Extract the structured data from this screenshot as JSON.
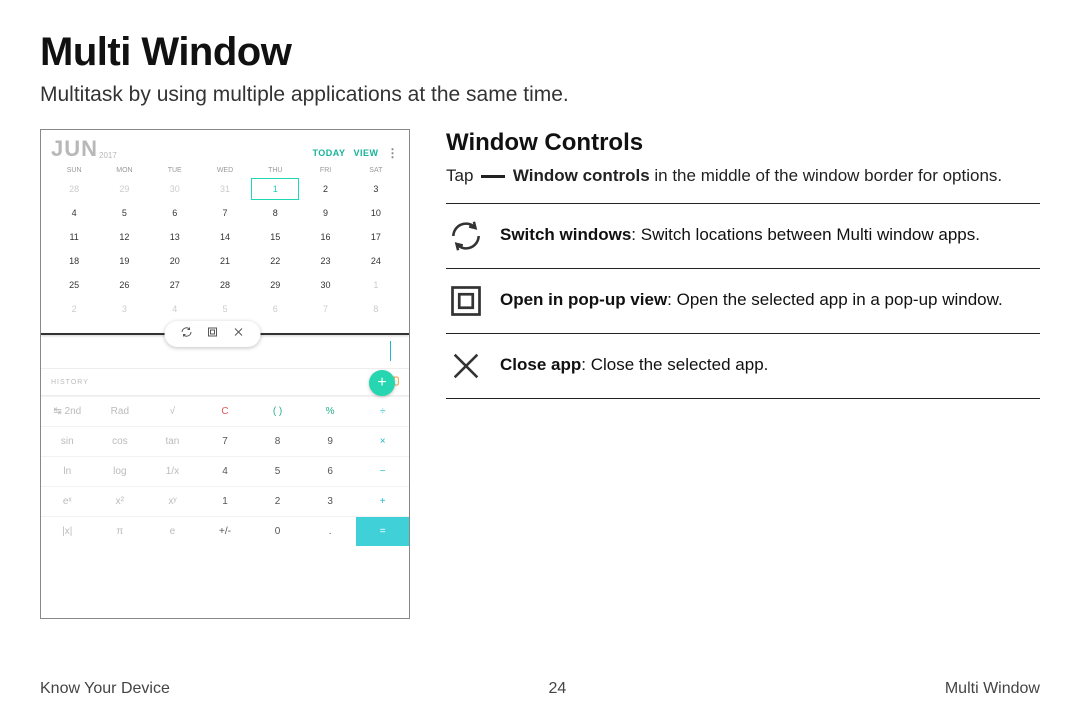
{
  "title": "Multi Window",
  "subtitle": "Multitask by using multiple applications at the same time.",
  "screenshot": {
    "calendar": {
      "month": "JUN",
      "year": "2017",
      "today_label": "TODAY",
      "view_label": "VIEW",
      "dow": [
        "SUN",
        "MON",
        "TUE",
        "WED",
        "THU",
        "FRI",
        "SAT"
      ],
      "weeks": [
        [
          "28",
          "29",
          "30",
          "31",
          "1",
          "2",
          "3"
        ],
        [
          "4",
          "5",
          "6",
          "7",
          "8",
          "9",
          "10"
        ],
        [
          "11",
          "12",
          "13",
          "14",
          "15",
          "16",
          "17"
        ],
        [
          "18",
          "19",
          "20",
          "21",
          "22",
          "23",
          "24"
        ],
        [
          "25",
          "26",
          "27",
          "28",
          "29",
          "30",
          "1"
        ],
        [
          "2",
          "3",
          "4",
          "5",
          "6",
          "7",
          "8"
        ]
      ]
    },
    "calculator": {
      "history_label": "HISTORY",
      "keys": [
        [
          "↹ 2nd",
          "Rad",
          "√",
          "C",
          "( )",
          "%",
          "÷"
        ],
        [
          "sin",
          "cos",
          "tan",
          "7",
          "8",
          "9",
          "×"
        ],
        [
          "ln",
          "log",
          "1/x",
          "4",
          "5",
          "6",
          "−"
        ],
        [
          "eˣ",
          "x²",
          "xʸ",
          "1",
          "2",
          "3",
          "+"
        ],
        [
          "|x|",
          "π",
          "e",
          "+/-",
          "0",
          ".",
          "="
        ]
      ]
    }
  },
  "doc": {
    "heading": "Window Controls",
    "intro_pre": "Tap ",
    "intro_bold": "Window controls",
    "intro_post": " in the middle of the window border for options.",
    "features": [
      {
        "id": "switch",
        "bold": "Switch windows",
        "rest": ": Switch locations between Multi window apps."
      },
      {
        "id": "popup",
        "bold": "Open in pop-up view",
        "rest": ": Open the selected app in a pop-up window."
      },
      {
        "id": "close",
        "bold": "Close app",
        "rest": ": Close the selected app."
      }
    ]
  },
  "footer": {
    "left": "Know Your Device",
    "center": "24",
    "right": "Multi Window"
  }
}
